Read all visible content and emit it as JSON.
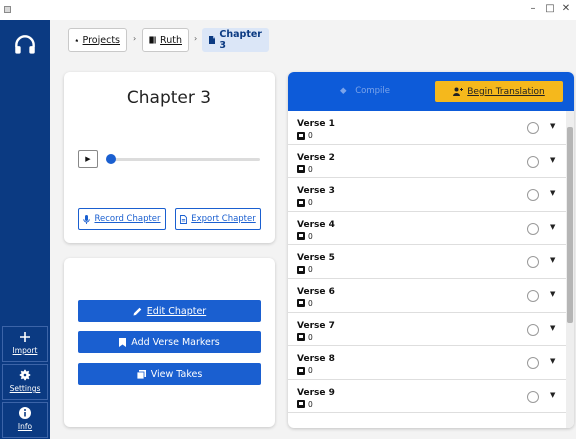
{
  "window": {
    "minimize_glyph": "–",
    "maximize_glyph": "□",
    "close_glyph": "✕"
  },
  "sidebar": {
    "logo_icon": "headphones-icon",
    "items": [
      {
        "label": "Import",
        "icon": "plus-icon"
      },
      {
        "label": "Settings",
        "icon": "gear-icon"
      },
      {
        "label": "Info",
        "icon": "info-icon"
      }
    ]
  },
  "breadcrumb": {
    "items": [
      {
        "label": "Projects",
        "icon": "home-icon"
      },
      {
        "label": "Ruth",
        "icon": "book-icon"
      },
      {
        "label": "Chapter 3",
        "icon": "document-icon"
      }
    ],
    "separator": "›"
  },
  "chapter": {
    "title": "Chapter 3",
    "playback_progress": 0,
    "record_label": "Record Chapter",
    "export_label": "Export Chapter"
  },
  "actions": {
    "edit_label": "Edit Chapter",
    "markers_label": "Add Verse Markers",
    "takes_label": "View Takes"
  },
  "verses_panel": {
    "compile_label": "Compile",
    "begin_label": "Begin Translation",
    "verses": [
      {
        "name": "Verse 1",
        "takes": "0"
      },
      {
        "name": "Verse 2",
        "takes": "0"
      },
      {
        "name": "Verse 3",
        "takes": "0"
      },
      {
        "name": "Verse 4",
        "takes": "0"
      },
      {
        "name": "Verse 5",
        "takes": "0"
      },
      {
        "name": "Verse 6",
        "takes": "0"
      },
      {
        "name": "Verse 7",
        "takes": "0"
      },
      {
        "name": "Verse 8",
        "takes": "0"
      },
      {
        "name": "Verse 9",
        "takes": "0"
      }
    ]
  },
  "colors": {
    "rail": "#0b3a82",
    "primary": "#1a5fd0",
    "header": "#0d5bd9",
    "accent": "#f5b81c"
  }
}
